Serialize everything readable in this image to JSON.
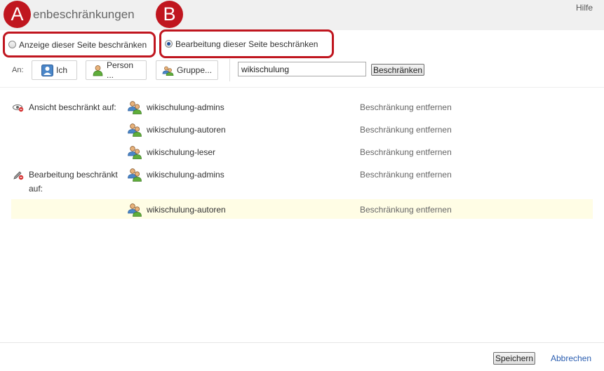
{
  "dialog": {
    "title": "enbeschränkungen",
    "help_label": "Hilfe"
  },
  "markers": {
    "a": "A",
    "b": "B"
  },
  "mode": {
    "view_label": "Anzeige dieser Seite beschränken",
    "edit_label": "Bearbeitung dieser Seite beschränken",
    "selected": "edit"
  },
  "target": {
    "to_label": "An:",
    "me_label": "Ich",
    "person_label": "Person ...",
    "group_label": "Gruppe...",
    "search_value": "wikischulung",
    "restrict_label": "Beschränken"
  },
  "restrictions": {
    "view": {
      "label": "Ansicht beschränkt auf:",
      "groups": [
        "wikischulung-admins",
        "wikischulung-autoren",
        "wikischulung-leser"
      ]
    },
    "edit": {
      "label": "Bearbeitung beschränkt auf:",
      "groups": [
        "wikischulung-admins",
        "wikischulung-autoren"
      ]
    },
    "remove_label": "Beschränkung entfernen"
  },
  "footer": {
    "save_label": "Speichern",
    "cancel_label": "Abbrechen"
  },
  "colors": {
    "marker": "#c0161f",
    "header_bg": "#f0f0f0",
    "highlight_row": "#fffde5",
    "link": "#2a5db0"
  }
}
